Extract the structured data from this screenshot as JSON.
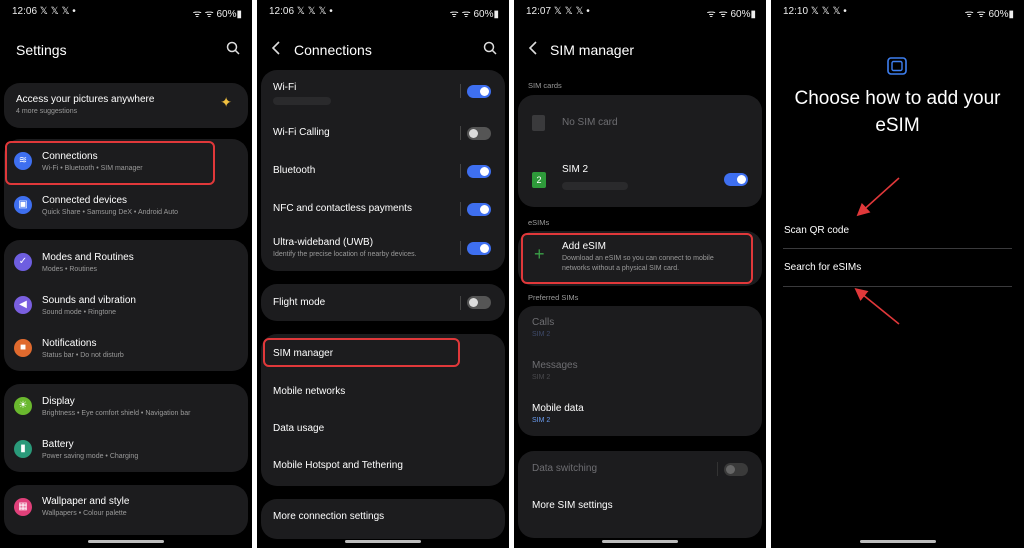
{
  "p1": {
    "time": "12:06 𝕏 𝕏 𝕏 •",
    "status_right": "ᯤ ᯤ 60%▮",
    "title": "Settings",
    "suggestion": {
      "title": "Access your pictures anywhere",
      "sub": "4 more suggestions"
    },
    "items": [
      {
        "label": "Connections",
        "sub": "Wi-Fi  •  Bluetooth  •  SIM manager"
      },
      {
        "label": "Connected devices",
        "sub": "Quick Share  •  Samsung DeX  •  Android Auto"
      },
      {
        "label": "Modes and Routines",
        "sub": "Modes  •  Routines"
      },
      {
        "label": "Sounds and vibration",
        "sub": "Sound mode  •  Ringtone"
      },
      {
        "label": "Notifications",
        "sub": "Status bar  •  Do not disturb"
      },
      {
        "label": "Display",
        "sub": "Brightness  •  Eye comfort shield  •  Navigation bar"
      },
      {
        "label": "Battery",
        "sub": "Power saving mode  •  Charging"
      },
      {
        "label": "Wallpaper and style",
        "sub": "Wallpapers  •  Colour palette"
      }
    ]
  },
  "p2": {
    "time": "12:06 𝕏 𝕏 𝕏 •",
    "status_right": "ᯤ ᯤ 60%▮",
    "title": "Connections",
    "items": [
      {
        "label": "Wi-Fi"
      },
      {
        "label": "Wi-Fi Calling"
      },
      {
        "label": "Bluetooth"
      },
      {
        "label": "NFC and contactless payments"
      },
      {
        "label": "Ultra-wideband (UWB)",
        "sub": "Identify the precise location of nearby devices."
      },
      {
        "label": "Flight mode"
      },
      {
        "label": "SIM manager"
      },
      {
        "label": "Mobile networks"
      },
      {
        "label": "Data usage"
      },
      {
        "label": "Mobile Hotspot and Tethering"
      },
      {
        "label": "More connection settings"
      }
    ]
  },
  "p3": {
    "time": "12:07 𝕏 𝕏 𝕏 •",
    "status_right": "ᯤ ᯤ 60%▮",
    "title": "SIM manager",
    "sect_sim": "SIM cards",
    "no_sim": "No SIM card",
    "sim2": "SIM 2",
    "sim2_badge": "2",
    "sect_esim": "eSIMs",
    "add_esim": "Add eSIM",
    "add_esim_sub1": "Download an eSIM so you can connect to mobile",
    "add_esim_sub2": "networks without a physical SIM card.",
    "sect_pref": "Preferred SIMs",
    "calls": "Calls",
    "calls_sub": "SIM 2",
    "messages": "Messages",
    "messages_sub": "SIM 2",
    "mobile_data": "Mobile data",
    "mobile_data_sub": "SIM 2",
    "data_switching": "Data switching",
    "more_sim": "More SIM settings"
  },
  "p4": {
    "time": "12:10 𝕏 𝕏 𝕏 •",
    "status_right": "ᯤ ᯤ 60%▮",
    "heading_1": "Choose how to add your",
    "heading_2": "eSIM",
    "scan_qr": "Scan QR code",
    "search": "Search for eSIMs"
  },
  "colors": {
    "accent": "#3e6ff0",
    "highlight": "#e0383a"
  }
}
